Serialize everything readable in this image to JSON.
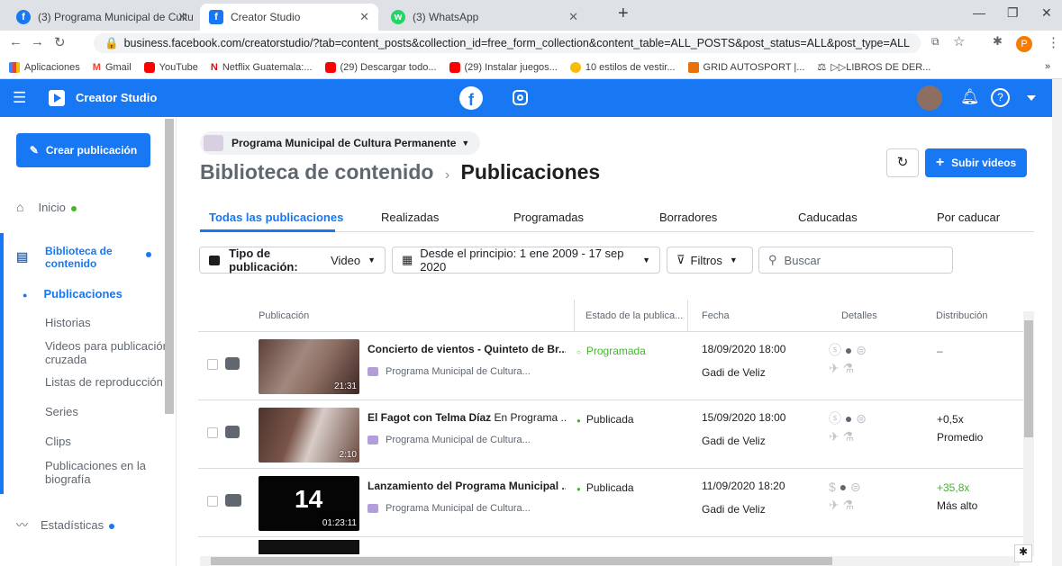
{
  "browser": {
    "tabs": [
      {
        "label": "(3) Programa Municipal de Cultu"
      },
      {
        "label": "Creator Studio"
      },
      {
        "label": "(3) WhatsApp"
      }
    ],
    "url": "business.facebook.com/creatorstudio/?tab=content_posts&collection_id=free_form_collection&content_table=ALL_POSTS&post_status=ALL&post_type=ALL",
    "bookmarks": [
      "Aplicaciones",
      "Gmail",
      "YouTube",
      "Netflix Guatemala:...",
      "(29) Descargar todo...",
      "(29) Instalar juegos...",
      "10 estilos de vestir...",
      "GRID AUTOSPORT |...",
      "▷▷LIBROS DE DER..."
    ],
    "profile_initial": "P"
  },
  "header": {
    "title": "Creator Studio"
  },
  "sidebar": {
    "create_label": "Crear publicación",
    "items": [
      {
        "label": "Inicio"
      },
      {
        "label": "Biblioteca de contenido"
      },
      {
        "label": "Publicaciones"
      },
      {
        "label": "Historias"
      },
      {
        "label": "Videos para publicación cruzada"
      },
      {
        "label": "Listas de reproducción"
      },
      {
        "label": "Series"
      },
      {
        "label": "Clips"
      },
      {
        "label": "Publicaciones en la biografía"
      },
      {
        "label": "Estadísticas"
      }
    ]
  },
  "main": {
    "page_name": "Programa Municipal de Cultura Permanente",
    "breadcrumb_parent": "Biblioteca de contenido",
    "breadcrumb_current": "Publicaciones",
    "upload_label": "Subir videos",
    "tabs": [
      {
        "label": "Todas las publicaciones"
      },
      {
        "label": "Realizadas"
      },
      {
        "label": "Programadas"
      },
      {
        "label": "Borradores"
      },
      {
        "label": "Caducadas"
      },
      {
        "label": "Por caducar"
      }
    ],
    "filters": {
      "type_label": "Tipo de publicación:",
      "type_value": "Video",
      "date_label": "Desde el principio: 1 ene 2009 - 17 sep 2020",
      "filters_label": "Filtros",
      "search_placeholder": "Buscar"
    },
    "columns": [
      "Publicación",
      "Estado de la publica...",
      "Fecha",
      "Detalles",
      "Distribución"
    ],
    "rows": [
      {
        "duration": "21:31",
        "title": "Concierto de vientos - Quinteto de Br...",
        "page": "Programa Municipal de Cultura...",
        "status": "Programada",
        "status_color": "#42b72a",
        "date": "18/09/2020 18:00",
        "author": "Gadi de Veliz",
        "dist1": "–",
        "dist2": ""
      },
      {
        "duration": "2:10",
        "title": "El Fagot con Telma Díaz",
        "title_rest": "En Programa ...",
        "page": "Programa Municipal de Cultura...",
        "status": "Publicada",
        "status_color": "#1c1e21",
        "date": "15/09/2020 18:00",
        "author": "Gadi de Veliz",
        "dist1": "+0,5x",
        "dist2": "Promedio"
      },
      {
        "duration": "01:23:11",
        "thumb_text": "14",
        "title": "Lanzamiento del Programa Municipal ...",
        "page": "Programa Municipal de Cultura...",
        "status": "Publicada",
        "status_color": "#1c1e21",
        "date": "11/09/2020 18:20",
        "author": "Gadi de Veliz",
        "dist1": "+35,8x",
        "dist2": "Más alto"
      }
    ]
  },
  "colors": {
    "brand": "#1877f2",
    "green": "#42b72a"
  }
}
